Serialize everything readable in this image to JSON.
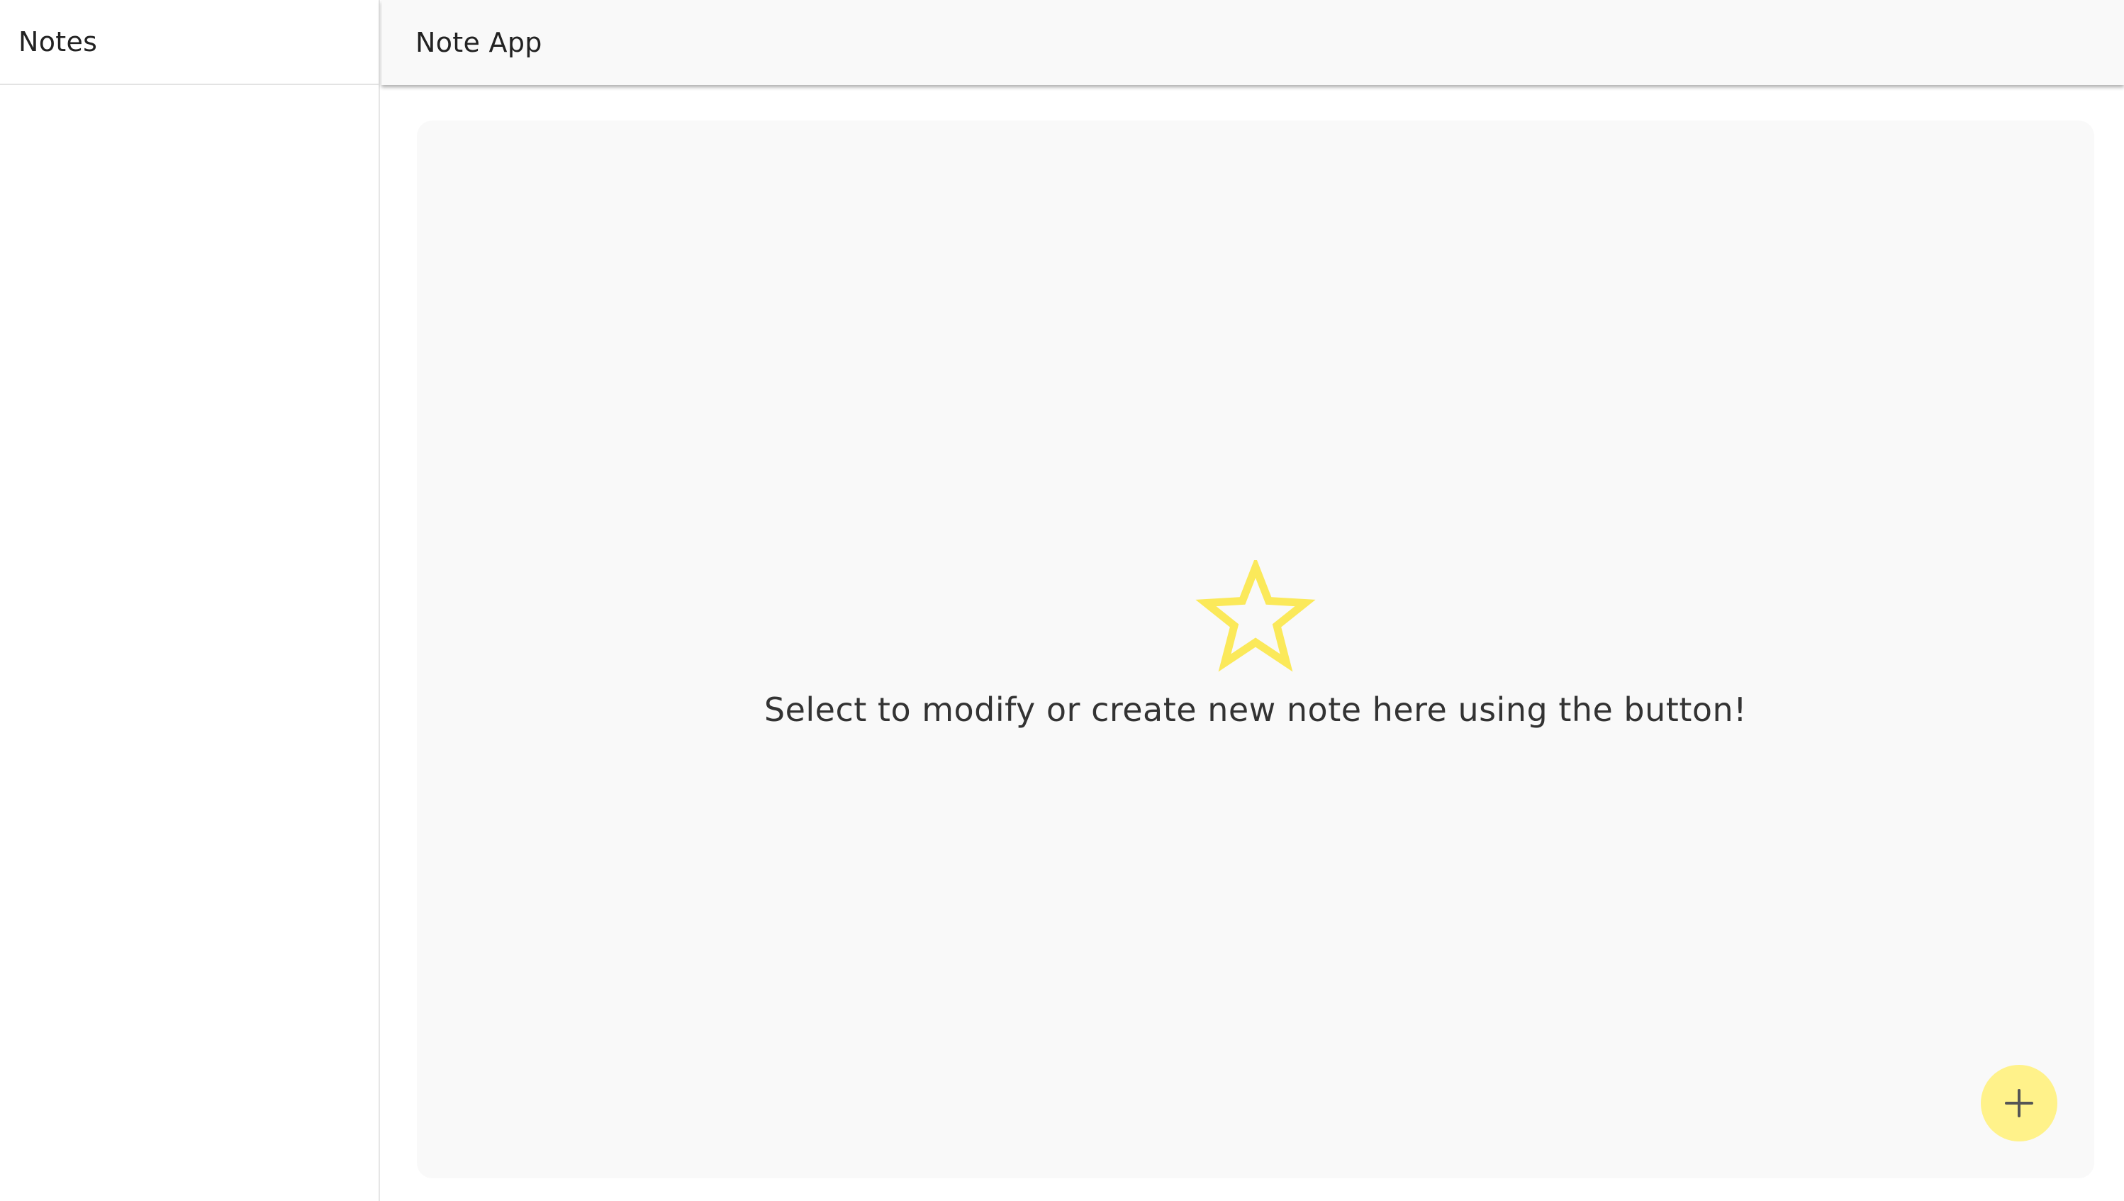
{
  "sidebar": {
    "title": "Notes",
    "items": []
  },
  "header": {
    "title": "Note App"
  },
  "main": {
    "empty_message": "Select to modify or create new note here using the button!",
    "empty_icon": "star-outline-icon"
  },
  "fab": {
    "icon": "plus-icon"
  },
  "colors": {
    "accent": "#fff28a",
    "star": "#fbe95a",
    "panel_bg": "#f9f9f9",
    "text": "#333333"
  }
}
